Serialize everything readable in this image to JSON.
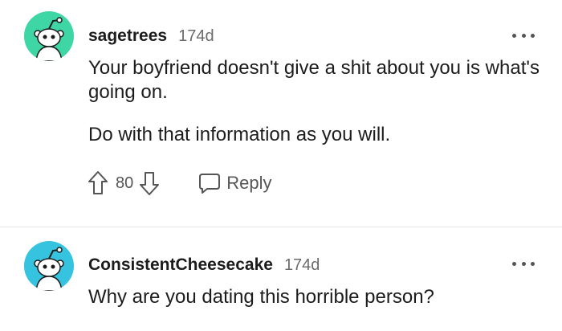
{
  "comments": [
    {
      "username": "sagetrees",
      "time": "174d",
      "paragraphs": [
        "Your boyfriend doesn't give a shit about you is what's going on.",
        "Do with that information as you will."
      ],
      "score": "80",
      "reply_label": "Reply",
      "avatar_color": "#3fd6a6"
    },
    {
      "username": "ConsistentCheesecake",
      "time": "174d",
      "paragraphs": [
        "Why are you dating this horrible person?"
      ],
      "avatar_color": "#35c3e0"
    }
  ],
  "icons": {
    "upvote": "arrow-up-outline-icon",
    "downvote": "arrow-down-outline-icon",
    "reply": "speech-bubble-icon",
    "more": "three-dots-horizontal-icon",
    "avatar": "snoo-avatar-icon"
  }
}
